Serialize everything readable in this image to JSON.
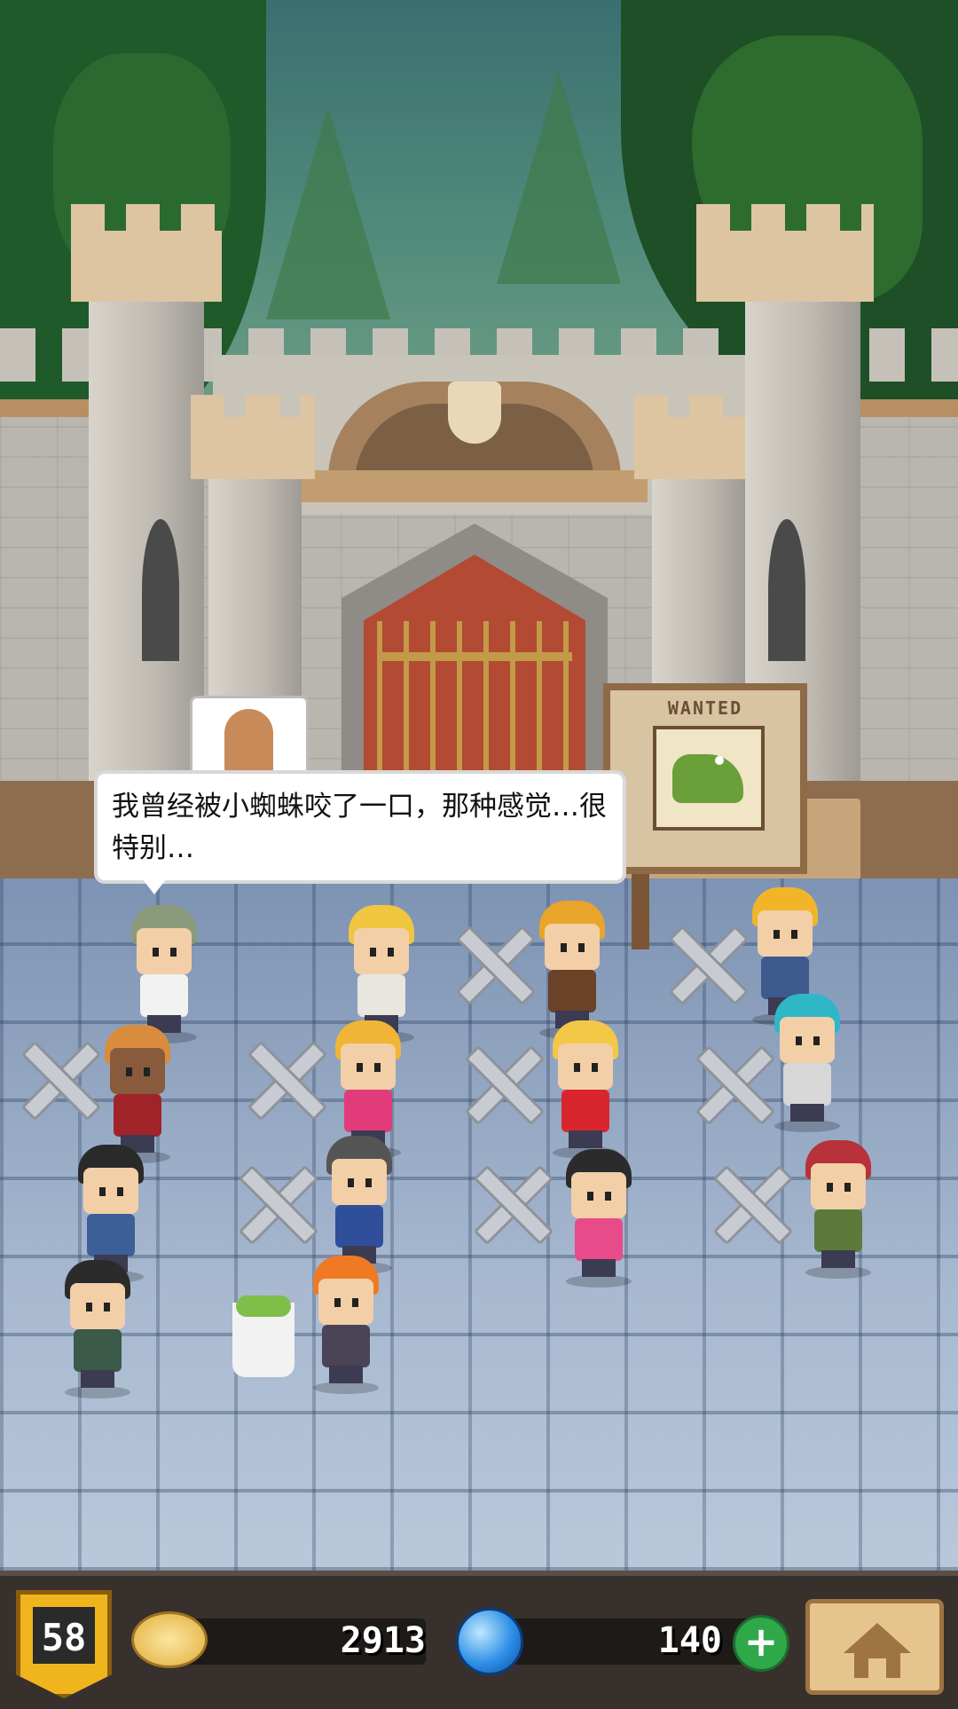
{
  "dialog": {
    "text": "我曾经被小蜘蛛咬了一口，那种感觉…很特别…",
    "icon": "door-icon"
  },
  "poster": {
    "title": "WANTED",
    "subject": "crocodile-icon"
  },
  "hud": {
    "level": "58",
    "coins": "2913",
    "gems": "140",
    "plus_label": "+",
    "home_icon": "home-icon"
  },
  "colors": {
    "gold": "#f0b51c",
    "gem_blue": "#2e8fe6",
    "plus_green": "#2fa84a",
    "hud_bg": "#37302c"
  }
}
